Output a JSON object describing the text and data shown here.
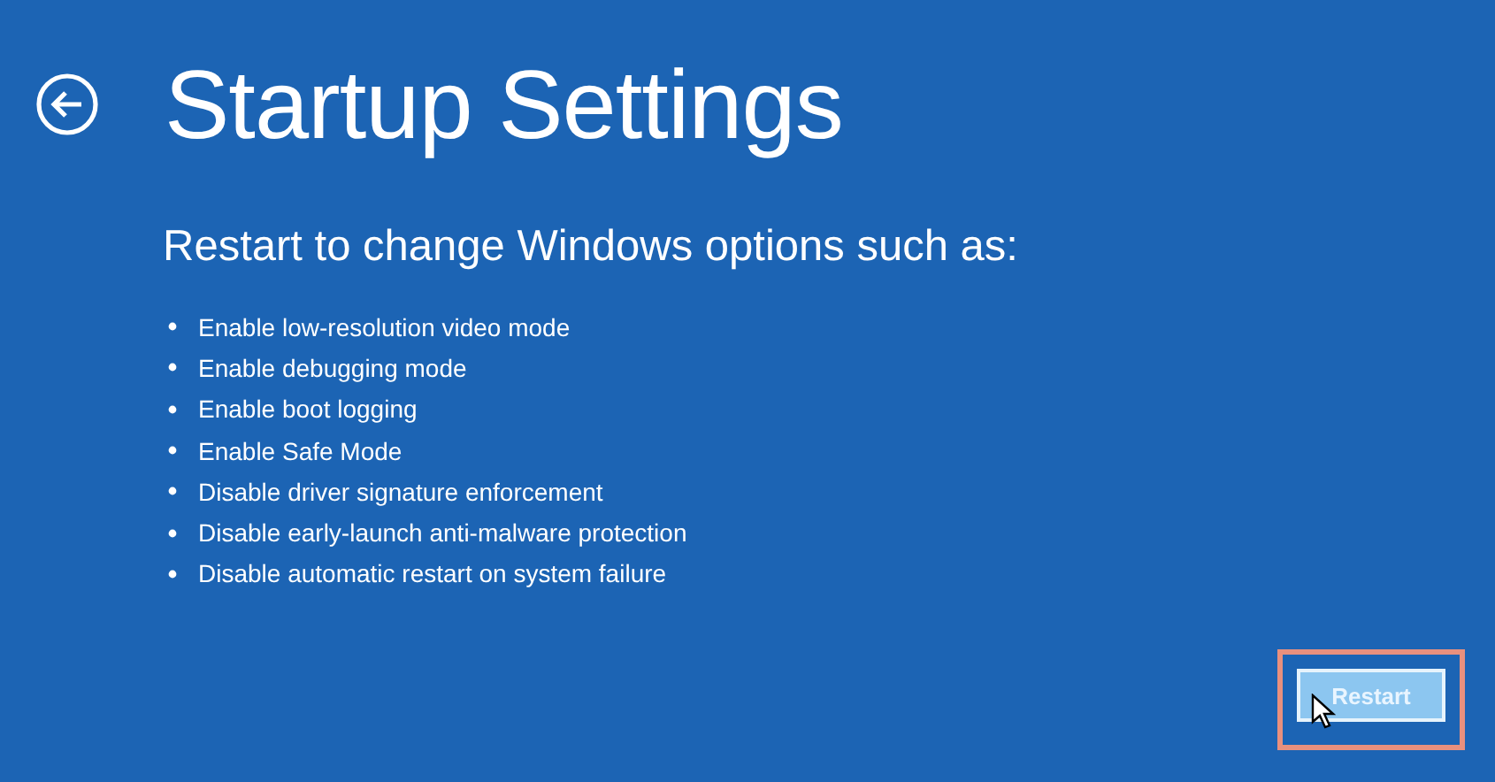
{
  "title": "Startup Settings",
  "subtitle": "Restart to change Windows options such as:",
  "options": [
    "Enable low-resolution video mode",
    "Enable debugging mode",
    "Enable boot logging",
    "Enable Safe Mode",
    "Disable driver signature enforcement",
    "Disable early-launch anti-malware protection",
    "Disable automatic restart on system failure"
  ],
  "restart_button": {
    "label": "Restart",
    "highlighted": true
  }
}
